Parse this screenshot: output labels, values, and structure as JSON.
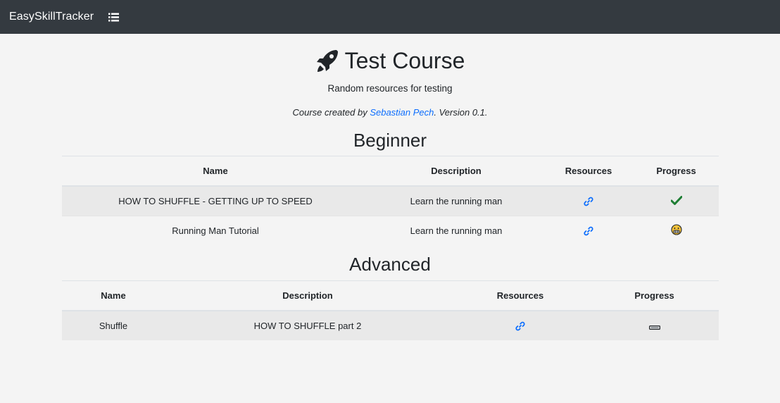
{
  "navbar": {
    "brand": "EasySkillTracker",
    "menu_icon": "list-icon"
  },
  "course": {
    "icon": "rocket-icon",
    "title": "Test Course",
    "description": "Random resources for testing",
    "credit_prefix": "Course created by ",
    "author": "Sebastian Pech",
    "credit_suffix": ". Version 0.1."
  },
  "sections": [
    {
      "title": "Beginner",
      "columns": [
        "Name",
        "Description",
        "Resources",
        "Progress"
      ],
      "rows": [
        {
          "name": "HOW TO SHUFFLE - GETTING UP TO SPEED",
          "description": "Learn the running man",
          "resource_icon": "link-icon",
          "progress_icon": "check-icon"
        },
        {
          "name": "Running Man Tutorial",
          "description": "Learn the running man",
          "resource_icon": "link-icon",
          "progress_icon": "grimace-face-icon"
        }
      ]
    },
    {
      "title": "Advanced",
      "columns": [
        "Name",
        "Description",
        "Resources",
        "Progress"
      ],
      "rows": [
        {
          "name": "Shuffle",
          "description": "HOW TO SHUFFLE part 2",
          "resource_icon": "link-icon",
          "progress_icon": "minus-icon"
        }
      ]
    }
  ],
  "colors": {
    "navbar_bg": "#343a40",
    "page_bg": "#f4f4f4",
    "link": "#0d6efd",
    "check": "#1e7e34",
    "stripe": "#e9e9e9"
  }
}
